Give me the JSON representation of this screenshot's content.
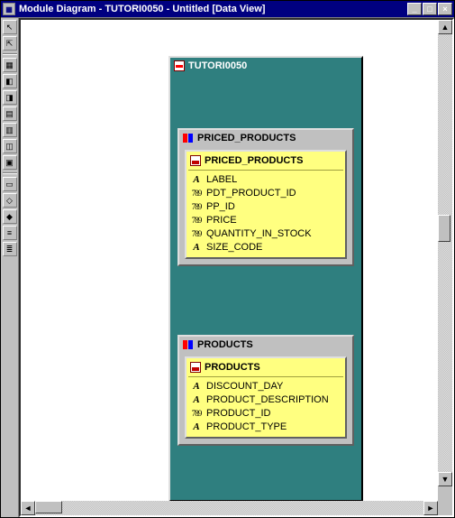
{
  "window": {
    "title": "Module Diagram - TUTORI0050 - Untitled [Data View]"
  },
  "module": {
    "name": "TUTORI0050"
  },
  "blocks": [
    {
      "key": "priced_products",
      "header": "PRICED_PRODUCTS",
      "table": "PRICED_PRODUCTS",
      "columns": [
        {
          "type": "A",
          "name": "LABEL"
        },
        {
          "type": "789",
          "name": "PDT_PRODUCT_ID"
        },
        {
          "type": "789",
          "name": "PP_ID"
        },
        {
          "type": "789",
          "name": "PRICE"
        },
        {
          "type": "789",
          "name": "QUANTITY_IN_STOCK"
        },
        {
          "type": "A",
          "name": "SIZE_CODE"
        }
      ]
    },
    {
      "key": "products",
      "header": "PRODUCTS",
      "table": "PRODUCTS",
      "columns": [
        {
          "type": "A",
          "name": "DISCOUNT_DAY"
        },
        {
          "type": "A",
          "name": "PRODUCT_DESCRIPTION"
        },
        {
          "type": "789",
          "name": "PRODUCT_ID"
        },
        {
          "type": "A",
          "name": "PRODUCT_TYPE"
        }
      ]
    }
  ],
  "icons": {
    "t0": "↖",
    "t1": "⇱",
    "t2": "▦",
    "t3": "◧",
    "t4": "◨",
    "t5": "▤",
    "t6": "▥",
    "t7": "◫",
    "t8": "▣",
    "t9": "▭",
    "t10": "◇",
    "t11": "◆",
    "t12": "≡",
    "t13": "≣"
  }
}
